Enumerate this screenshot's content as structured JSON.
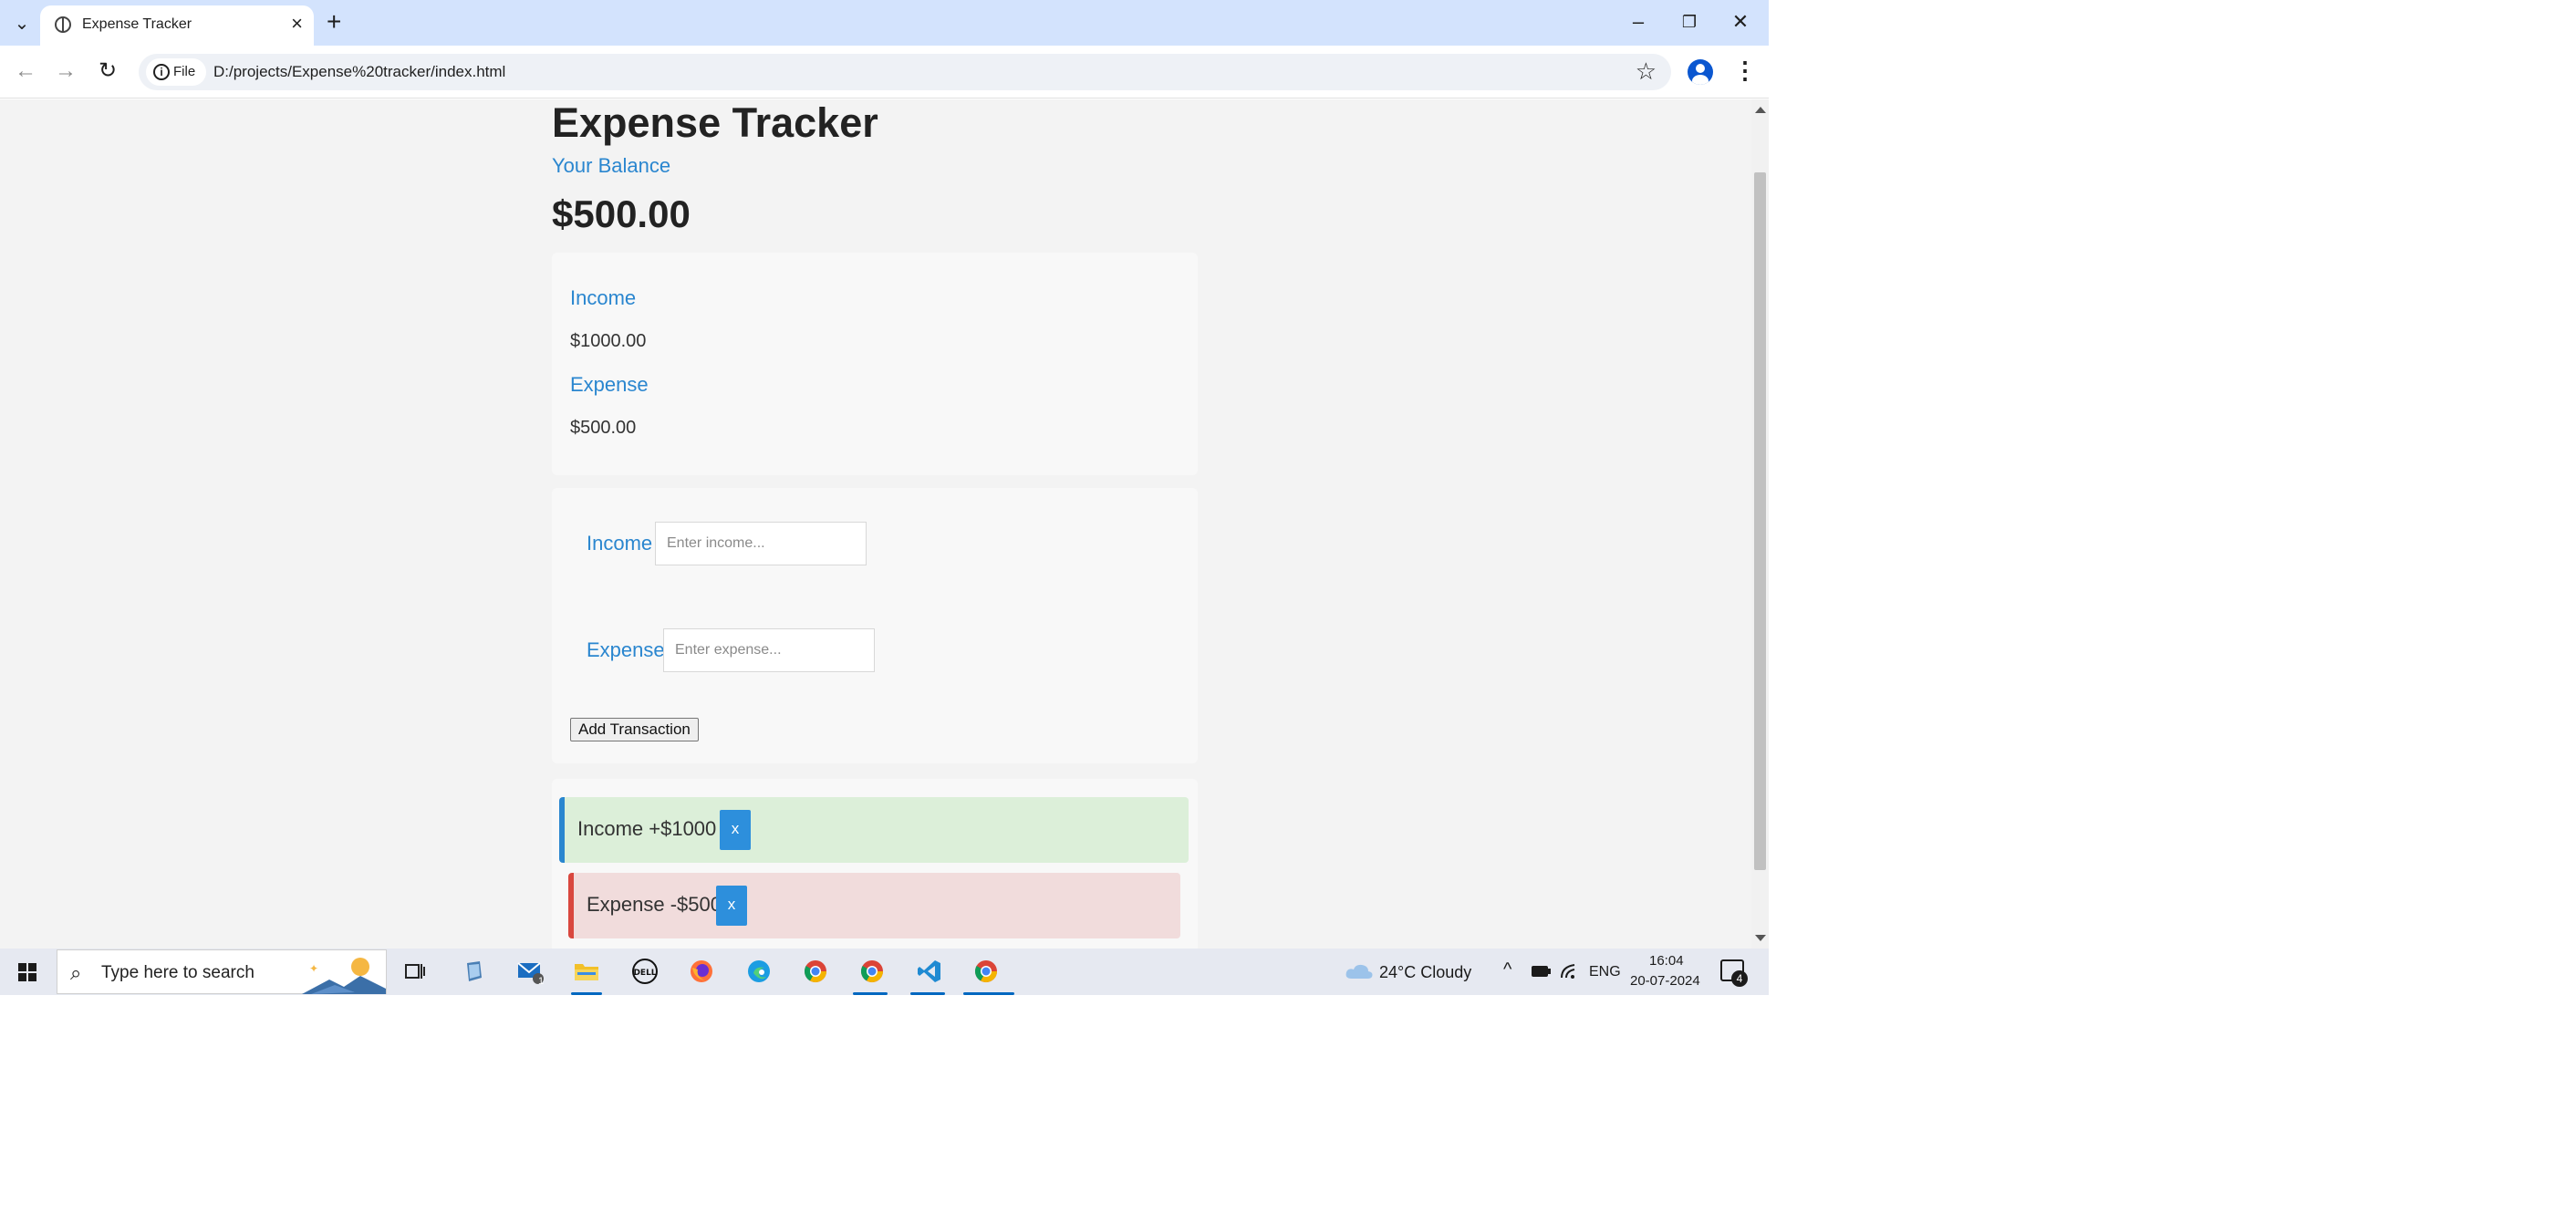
{
  "browser": {
    "tab_title": "Expense Tracker",
    "chip_label": "File",
    "url": "D:/projects/Expense%20tracker/index.html"
  },
  "app": {
    "title": "Expense Tracker",
    "balance_label": "Your Balance",
    "balance_value": "$500.00",
    "summary": {
      "income_label": "Income",
      "income_value": "$1000.00",
      "expense_label": "Expense",
      "expense_value": "$500.00"
    },
    "form": {
      "income_label": "Income",
      "income_placeholder": "Enter income...",
      "expense_label": "Expense",
      "expense_placeholder": "Enter expense...",
      "submit_label": "Add Transaction"
    },
    "transactions": [
      {
        "type": "income",
        "text": "Income +$1000",
        "delete_label": "x"
      },
      {
        "type": "expense",
        "text": "Expense -$500",
        "delete_label": "x"
      }
    ]
  },
  "taskbar": {
    "search_placeholder": "Type here to search",
    "mail_badge": "1",
    "weather": "24°C  Cloudy",
    "language": "ENG",
    "time": "16:04",
    "date": "20-07-2024",
    "notification_count": "4"
  },
  "colors": {
    "accent_blue": "#2a86cf",
    "income_bg": "#dcefd9",
    "expense_bg": "#f1dcdc",
    "expense_border": "#d9473e",
    "delete_button": "#2d8fdc"
  }
}
